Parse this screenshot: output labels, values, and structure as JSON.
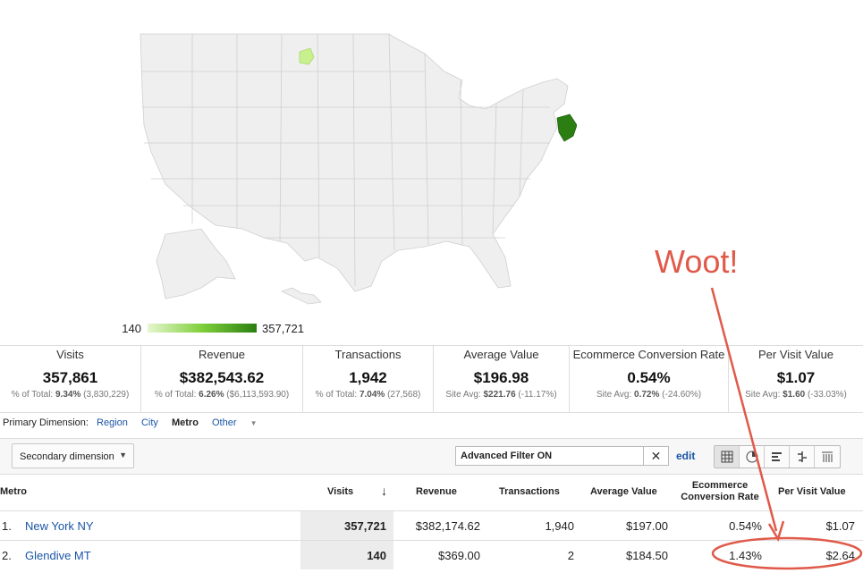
{
  "map": {
    "legend_min": "140",
    "legend_max": "357,721",
    "colors": {
      "low": "#c9f08f",
      "high": "#2b7f12",
      "land": "#efefef",
      "border": "#cfcfcf"
    }
  },
  "annotation": {
    "text": "Woot!",
    "color": "#e05a4a"
  },
  "scorecard": [
    {
      "title": "Visits",
      "value": "357,861",
      "sub_prefix": "% of Total: ",
      "sub_bold": "9.34%",
      "sub_rest": " (3,830,229)"
    },
    {
      "title": "Revenue",
      "value": "$382,543.62",
      "sub_prefix": "% of Total: ",
      "sub_bold": "6.26%",
      "sub_rest": " ($6,113,593.90)"
    },
    {
      "title": "Transactions",
      "value": "1,942",
      "sub_prefix": "% of Total: ",
      "sub_bold": "7.04%",
      "sub_rest": " (27,568)"
    },
    {
      "title": "Average Value",
      "value": "$196.98",
      "sub_prefix": "Site Avg: ",
      "sub_bold": "$221.76",
      "sub_rest": " (-11.17%)"
    },
    {
      "title": "Ecommerce Conversion Rate",
      "value": "0.54%",
      "sub_prefix": "Site Avg: ",
      "sub_bold": "0.72%",
      "sub_rest": " (-24.60%)"
    },
    {
      "title": "Per Visit Value",
      "value": "$1.07",
      "sub_prefix": "Site Avg: ",
      "sub_bold": "$1.60",
      "sub_rest": " (-33.03%)"
    }
  ],
  "primary_dimension": {
    "label": "Primary Dimension:",
    "options": [
      "Region",
      "City",
      "Metro",
      "Other"
    ],
    "active": "Metro"
  },
  "toolbar": {
    "secondary_dimension": "Secondary dimension",
    "filter_text": "Advanced Filter ON",
    "edit": "edit"
  },
  "table": {
    "headers": {
      "metro": "Metro",
      "visits": "Visits",
      "revenue": "Revenue",
      "transactions": "Transactions",
      "avg_value": "Average Value",
      "conv_rate_1": "Ecommerce",
      "conv_rate_2": "Conversion Rate",
      "per_visit": "Per Visit Value"
    },
    "rows": [
      {
        "index": "1.",
        "metro": "New York NY",
        "visits": "357,721",
        "revenue": "$382,174.62",
        "transactions": "1,940",
        "avg_value": "$197.00",
        "conv_rate": "0.54%",
        "per_visit": "$1.07"
      },
      {
        "index": "2.",
        "metro": "Glendive MT",
        "visits": "140",
        "revenue": "$369.00",
        "transactions": "2",
        "avg_value": "$184.50",
        "conv_rate": "1.43%",
        "per_visit": "$2.64"
      }
    ]
  }
}
